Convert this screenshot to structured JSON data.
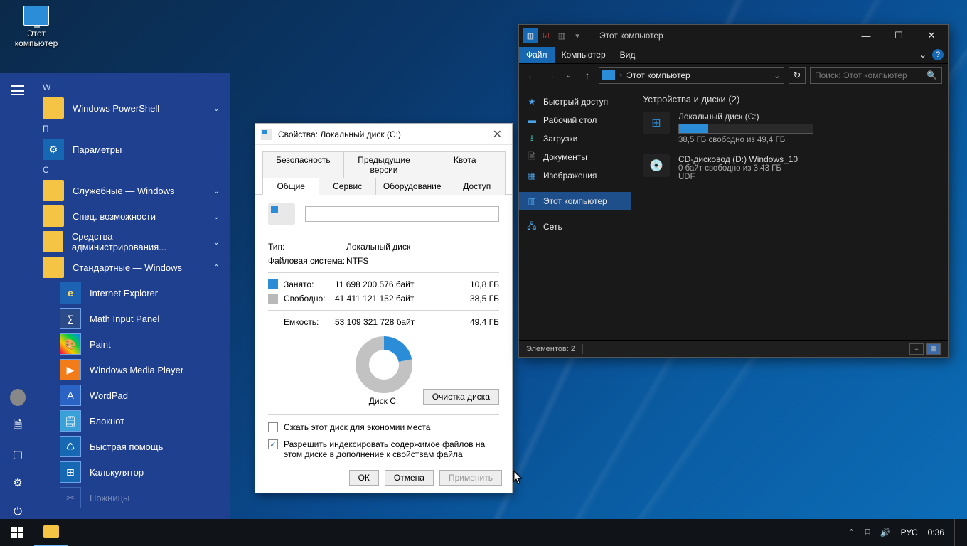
{
  "desktop": {
    "this_pc": "Этот\nкомпьютер"
  },
  "start": {
    "letters": {
      "w": "W",
      "p": "П",
      "c": "С"
    },
    "powershell": "Windows PowerShell",
    "settings": "Параметры",
    "utilities": "Служебные — Windows",
    "accessibility": "Спец. возможности",
    "admin_tools": "Средства администрирования...",
    "standard": "Стандартные — Windows",
    "ie": "Internet Explorer",
    "math": "Math Input Panel",
    "paint": "Paint",
    "wmp": "Windows Media Player",
    "wordpad": "WordPad",
    "notepad": "Блокнот",
    "quick_assist": "Быстрая помощь",
    "calculator": "Калькулятор",
    "scissors": "Ножницы"
  },
  "props": {
    "title": "Свойства: Локальный диск (C:)",
    "tabs": {
      "security": "Безопасность",
      "previous": "Предыдущие версии",
      "quota": "Квота",
      "general": "Общие",
      "service": "Сервис",
      "hardware": "Оборудование",
      "access": "Доступ"
    },
    "type_k": "Тип:",
    "type_v": "Локальный диск",
    "fs_k": "Файловая система:",
    "fs_v": "NTFS",
    "used_k": "Занято:",
    "used_bytes": "11 698 200 576 байт",
    "used_gb": "10,8 ГБ",
    "free_k": "Свободно:",
    "free_bytes": "41 411 121 152 байт",
    "free_gb": "38,5 ГБ",
    "cap_k": "Емкость:",
    "cap_bytes": "53 109 321 728 байт",
    "cap_gb": "49,4 ГБ",
    "disk_label": "Диск C:",
    "cleanup": "Очистка диска",
    "compress": "Сжать этот диск для экономии места",
    "index": "Разрешить индексировать содержимое файлов на этом диске в дополнение к свойствам файла",
    "ok": "ОК",
    "cancel": "Отмена",
    "apply": "Применить"
  },
  "explorer": {
    "title": "Этот компьютер",
    "ribbon": {
      "file": "Файл",
      "computer": "Компьютер",
      "view": "Вид"
    },
    "address": "Этот компьютер",
    "search_placeholder": "Поиск: Этот компьютер",
    "tree": {
      "quick": "Быстрый доступ",
      "desktop": "Рабочий стол",
      "downloads": "Загрузки",
      "documents": "Документы",
      "pictures": "Изображения",
      "this_pc": "Этот компьютер",
      "network": "Сеть"
    },
    "group": "Устройства и диски (2)",
    "driveC": {
      "title": "Локальный диск (C:)",
      "sub": "38,5 ГБ свободно из 49,4 ГБ",
      "fill_pct": 22
    },
    "driveD": {
      "title": "CD-дисковод (D:) Windows_10",
      "sub1": "0 байт свободно из 3,43 ГБ",
      "sub2": "UDF"
    },
    "status": "Элементов: 2"
  },
  "tray": {
    "lang": "РУС",
    "time": "0:36"
  },
  "chart_data": {
    "type": "pie",
    "title": "Диск C:",
    "series": [
      {
        "name": "Занято",
        "value": 11698200576,
        "value_gb": 10.8,
        "color": "#2b8dd8"
      },
      {
        "name": "Свободно",
        "value": 41411121152,
        "value_gb": 38.5,
        "color": "#c2c2c2"
      }
    ],
    "total_bytes": 53109321728,
    "total_gb": 49.4
  }
}
